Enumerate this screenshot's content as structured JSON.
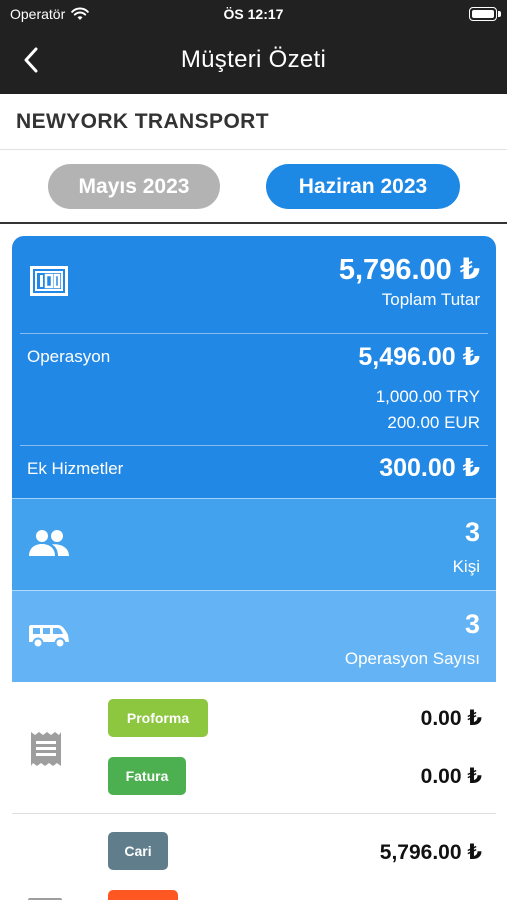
{
  "status_bar": {
    "carrier": "Operatör",
    "time": "ÖS 12:17"
  },
  "nav": {
    "title": "Müşteri Özeti"
  },
  "company": {
    "name": "NEWYORK TRANSPORT"
  },
  "months": {
    "previous": "Mayıs 2023",
    "current": "Haziran 2023"
  },
  "summary": {
    "total_value": "5,796.00 ₺",
    "total_label": "Toplam Tutar",
    "operation_label": "Operasyon",
    "operation_value": "5,496.00 ₺",
    "operation_try": "1,000.00 TRY",
    "operation_eur": "200.00 EUR",
    "extra_label": "Ek Hizmetler",
    "extra_value": "300.00 ₺"
  },
  "people": {
    "count": "3",
    "label": "Kişi"
  },
  "operations": {
    "count": "3",
    "label": "Operasyon Sayısı"
  },
  "documents": {
    "proforma_label": "Proforma",
    "proforma_value": "0.00 ₺",
    "invoice_label": "Fatura",
    "invoice_value": "0.00 ₺"
  },
  "accounts": {
    "cari_label": "Cari",
    "cari_value": "5,796.00 ₺"
  },
  "colors": {
    "nav_bg": "#212121",
    "accent_blue": "#1e88e5",
    "mid_blue": "#43a2ed",
    "light_blue": "#64b4f5",
    "proforma_green": "#8dc63f",
    "invoice_green": "#4caf50",
    "cari_gray": "#607d8b",
    "orange": "#ff5722"
  }
}
